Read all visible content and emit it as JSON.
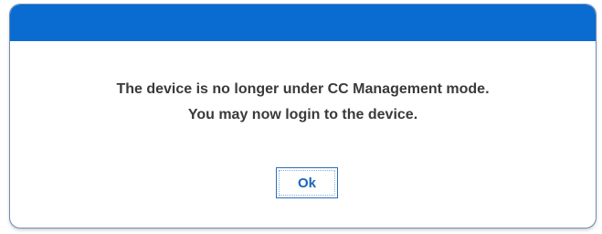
{
  "dialog": {
    "title_bar_color": "#0a6cd0",
    "message_line1": "The device is no longer under CC Management mode.",
    "message_line2": "You may now login to the device.",
    "ok_label": "Ok"
  }
}
